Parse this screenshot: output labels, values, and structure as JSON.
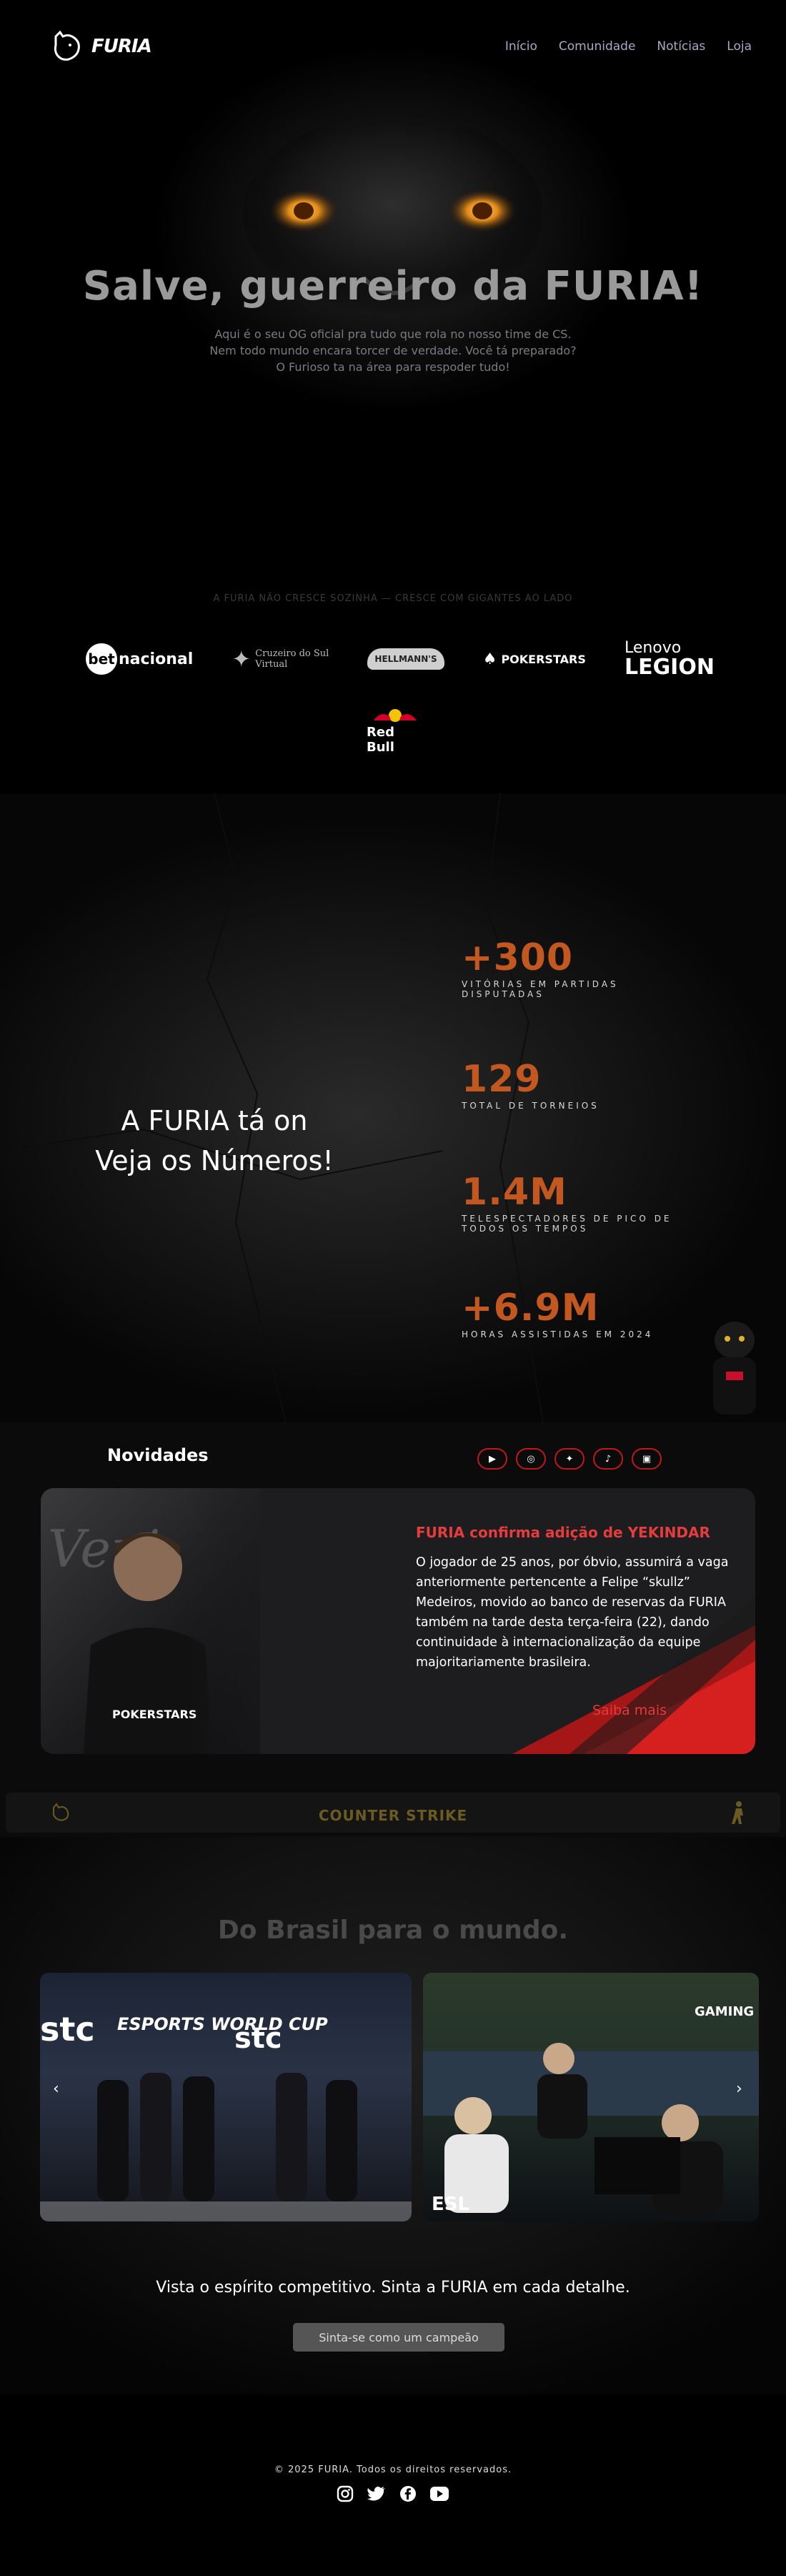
{
  "brand": {
    "name": "FURIA"
  },
  "nav": {
    "links": [
      {
        "label": "Início"
      },
      {
        "label": "Comunidade"
      },
      {
        "label": "Notícias"
      },
      {
        "label": "Loja"
      }
    ]
  },
  "hero": {
    "title": "Salve, guerreiro da FURIA!",
    "subtitle_lines": [
      "Aqui é o seu OG oficial pra tudo que rola no nosso time de CS.",
      "Nem todo mundo encara torcer de verdade. Você tá preparado?",
      "O Furioso ta na área para respoder tudo!"
    ]
  },
  "sponsors": {
    "tagline": "A FURIA NÃO CRESCE SOZINHA — CRESCE COM GIGANTES AO LADO",
    "logos": [
      {
        "name": "betnacional",
        "text_a": "bet",
        "text_b": "nacional"
      },
      {
        "name": "cruzeiro-do-sul-virtual",
        "line1": "Cruzeiro do Sul",
        "line2": "Virtual"
      },
      {
        "name": "hellmanns",
        "text": "HELLMANN'S"
      },
      {
        "name": "pokerstars",
        "text": "POKERSTARS"
      },
      {
        "name": "lenovo-legion",
        "line1": "Lenovo",
        "line2": "LEGION"
      },
      {
        "name": "red-bull",
        "text": "Red Bull"
      }
    ]
  },
  "stats": {
    "heading_lines": [
      "A FURIA tá on",
      "Veja os Números!"
    ],
    "items": [
      {
        "value": "+300",
        "label": "VITÓRIAS EM PARTIDAS DISPUTADAS"
      },
      {
        "value": "129",
        "label": "TOTAL DE TORNEIOS"
      },
      {
        "value": "1.4M",
        "label": "TELESPECTADORES DE PICO DE TODOS OS TEMPOS"
      },
      {
        "value": "+6.9M",
        "label": "HORAS ASSISTIDAS EM 2024"
      }
    ]
  },
  "news": {
    "section_title": "Novidades",
    "socials": [
      "youtube-icon",
      "instagram-icon",
      "twitter-icon",
      "tiktok-icon",
      "twitch-icon"
    ],
    "card": {
      "headline": "FURIA confirma adição de YEKINDAR",
      "body": "O jogador de 25 anos, por óbvio, assumirá a vaga anteriormente pertencente a Felipe “skullz” Medeiros, movido ao banco de reservas da FURIA também na tarde desta terça-feira (22), dando continuidade à internacionalização da equipe majoritariamente brasileira.",
      "link": "Saiba mais",
      "image_text": "POKERSTARS"
    }
  },
  "ticker": {
    "text": "COUNTER STRIKE"
  },
  "gallery": {
    "title": "Do Brasil para o mundo.",
    "slides": [
      {
        "brand_a": "stc",
        "brand_b": "ESPORTS WORLD CUP"
      },
      {
        "brand_a": "ESL",
        "brand_b": "GAMING MALTA"
      }
    ],
    "prev": "‹",
    "next": "›",
    "tagline": "Vista o espírito competitivo. Sinta a FURIA em cada detalhe.",
    "cta": "Sinta-se como um campeão"
  },
  "footer": {
    "copyright": "© 2025 FURIA. Todos os direitos reservados.",
    "icons": [
      "instagram-icon",
      "twitter-icon",
      "facebook-icon",
      "youtube-icon"
    ]
  },
  "colors": {
    "accent_orange": "#c2581f",
    "accent_red": "#e23b3b",
    "nav_link": "#a9a9c6",
    "ticker_gold": "#6b5a22"
  }
}
